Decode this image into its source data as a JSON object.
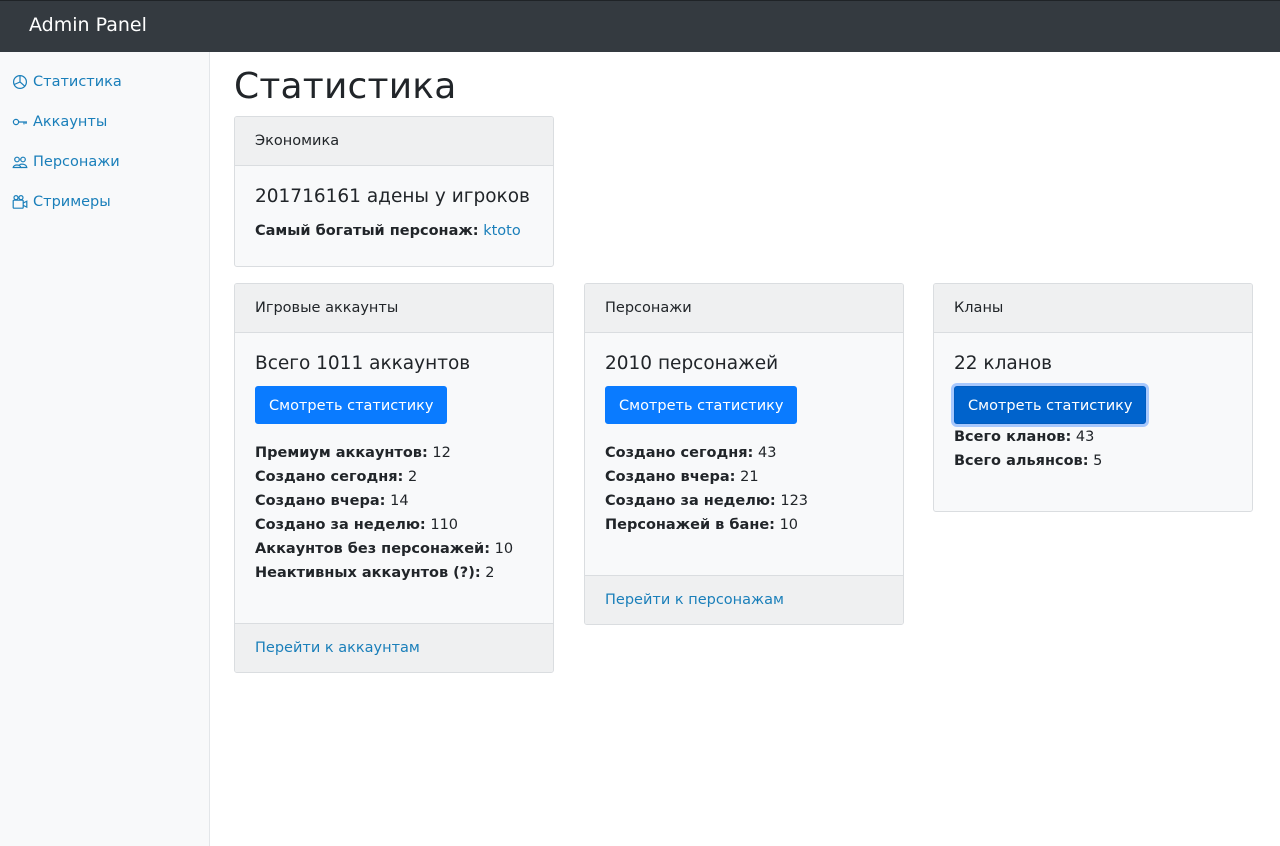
{
  "navbar": {
    "brand": "Admin Panel"
  },
  "sidebar": {
    "items": [
      {
        "label": "Статистика",
        "icon": "pie-chart-icon"
      },
      {
        "label": "Аккаунты",
        "icon": "key-icon"
      },
      {
        "label": "Персонажи",
        "icon": "users-icon"
      },
      {
        "label": "Стримеры",
        "icon": "video-camera-icon"
      }
    ]
  },
  "page": {
    "title": "Статистика"
  },
  "economy": {
    "header": "Экономика",
    "title": "201716161 адены у игроков",
    "richest_label": "Самый богатый персонаж:",
    "richest_value": "ktoto"
  },
  "accounts": {
    "header": "Игровые аккаунты",
    "title": "Всего 1011 аккаунтов",
    "button": "Смотреть статистику",
    "stats": [
      {
        "label": "Премиум аккаунтов:",
        "value": "12"
      },
      {
        "label": "Создано сегодня:",
        "value": "2"
      },
      {
        "label": "Создано вчера:",
        "value": "14"
      },
      {
        "label": "Создано за неделю:",
        "value": "110"
      },
      {
        "label": "Аккаунтов без персонажей:",
        "value": "10"
      },
      {
        "label": "Неактивных аккаунтов (?):",
        "value": "2"
      }
    ],
    "footer_link": "Перейти к аккаунтам"
  },
  "characters": {
    "header": "Персонажи",
    "title": "2010 персонажей",
    "button": "Смотреть статистику",
    "stats": [
      {
        "label": "Создано сегодня:",
        "value": "43"
      },
      {
        "label": "Создано вчера:",
        "value": "21"
      },
      {
        "label": "Создано за неделю:",
        "value": "123"
      },
      {
        "label": "Персонажей в бане:",
        "value": "10"
      }
    ],
    "footer_link": "Перейти к персонажам"
  },
  "clans": {
    "header": "Кланы",
    "title": "22 кланов",
    "button": "Смотреть статистику",
    "stats": [
      {
        "label": "Всего кланов:",
        "value": "43"
      },
      {
        "label": "Всего альянсов:",
        "value": "5"
      }
    ]
  },
  "colors": {
    "navbar": "#343a40",
    "link": "#1a7fba",
    "primary": "#0a7bff",
    "sidebar": "#f8f9fa"
  }
}
